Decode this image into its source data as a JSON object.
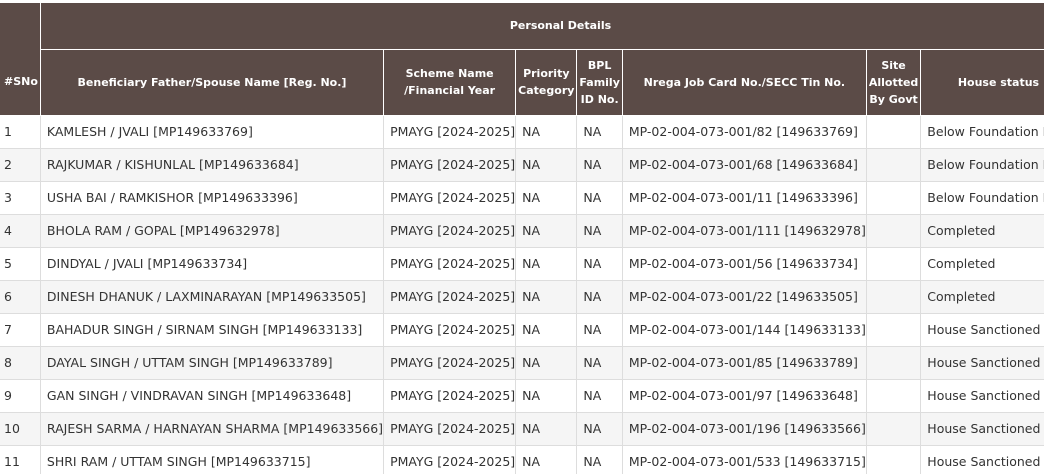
{
  "table": {
    "group_header": "Personal Details",
    "columns": [
      "#SNo",
      "Beneficiary Father/Spouse Name [Reg. No.]",
      "Scheme Name /Financial Year",
      "Priority Category",
      "BPL Family ID No.",
      "Nrega Job Card No./SECC Tin No.",
      "Site Allotted By Govt",
      "House status"
    ],
    "rows": [
      [
        "1",
        "KAMLESH / JVALI [MP149633769]",
        "PMAYG [2024-2025]",
        "NA",
        "NA",
        "MP-02-004-073-001/82 [149633769]",
        "",
        "Below Foundation Level"
      ],
      [
        "2",
        "RAJKUMAR / KISHUNLAL [MP149633684]",
        "PMAYG [2024-2025]",
        "NA",
        "NA",
        "MP-02-004-073-001/68 [149633684]",
        "",
        "Below Foundation Level"
      ],
      [
        "3",
        "USHA BAI / RAMKISHOR [MP149633396]",
        "PMAYG [2024-2025]",
        "NA",
        "NA",
        "MP-02-004-073-001/11 [149633396]",
        "",
        "Below Foundation Level"
      ],
      [
        "4",
        "BHOLA RAM / GOPAL [MP149632978]",
        "PMAYG [2024-2025]",
        "NA",
        "NA",
        "MP-02-004-073-001/111 [149632978]",
        "",
        "Completed"
      ],
      [
        "5",
        "DINDYAL / JVALI [MP149633734]",
        "PMAYG [2024-2025]",
        "NA",
        "NA",
        "MP-02-004-073-001/56 [149633734]",
        "",
        "Completed"
      ],
      [
        "6",
        "DINESH DHANUK / LAXMINARAYAN [MP149633505]",
        "PMAYG [2024-2025]",
        "NA",
        "NA",
        "MP-02-004-073-001/22 [149633505]",
        "",
        "Completed"
      ],
      [
        "7",
        "BAHADUR SINGH / SIRNAM SINGH [MP149633133]",
        "PMAYG [2024-2025]",
        "NA",
        "NA",
        "MP-02-004-073-001/144 [149633133]",
        "",
        "House Sanctioned"
      ],
      [
        "8",
        "DAYAL SINGH / UTTAM SINGH [MP149633789]",
        "PMAYG [2024-2025]",
        "NA",
        "NA",
        "MP-02-004-073-001/85 [149633789]",
        "",
        "House Sanctioned"
      ],
      [
        "9",
        "GAN SINGH / VINDRAVAN SINGH [MP149633648]",
        "PMAYG [2024-2025]",
        "NA",
        "NA",
        "MP-02-004-073-001/97 [149633648]",
        "",
        "House Sanctioned"
      ],
      [
        "10",
        "RAJESH SARMA / HARNAYAN SHARMA [MP149633566]",
        "PMAYG [2024-2025]",
        "NA",
        "NA",
        "MP-02-004-073-001/196 [149633566]",
        "",
        "House Sanctioned"
      ],
      [
        "11",
        "SHRI RAM / UTTAM SINGH [MP149633715]",
        "PMAYG [2024-2025]",
        "NA",
        "NA",
        "MP-02-004-073-001/533 [149633715]",
        "",
        "House Sanctioned"
      ]
    ]
  }
}
